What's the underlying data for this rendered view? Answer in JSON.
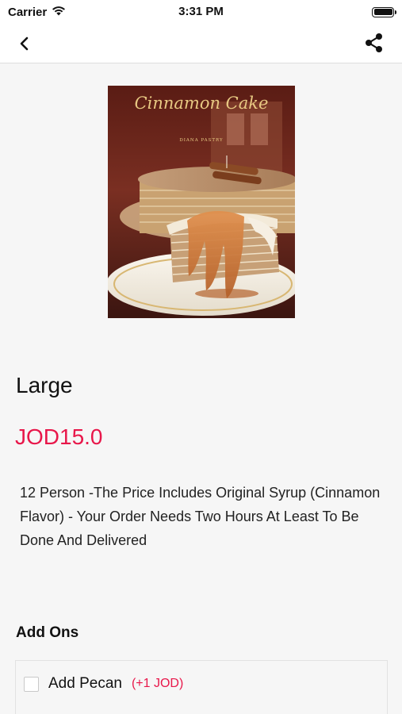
{
  "status_bar": {
    "carrier": "Carrier",
    "time": "3:31 PM"
  },
  "nav": {
    "back_icon": "chevron-left-icon",
    "share_icon": "share-icon"
  },
  "product": {
    "image_title": "Cinnamon Cake",
    "image_brand": "DIANA PASTRY",
    "size": "Large",
    "price": "JOD15.0",
    "description": "12 Person -The Price Includes Original Syrup (Cinnamon Flavor) - Your Order Needs Two Hours At Least To Be Done And Delivered"
  },
  "addons": {
    "title": "Add Ons",
    "items": [
      {
        "name": "Add Pecan",
        "price": "(+1 JOD)",
        "checked": false
      }
    ]
  },
  "colors": {
    "accent": "#e8174a",
    "background": "#f6f6f6",
    "nav_bg": "#ffffff"
  }
}
